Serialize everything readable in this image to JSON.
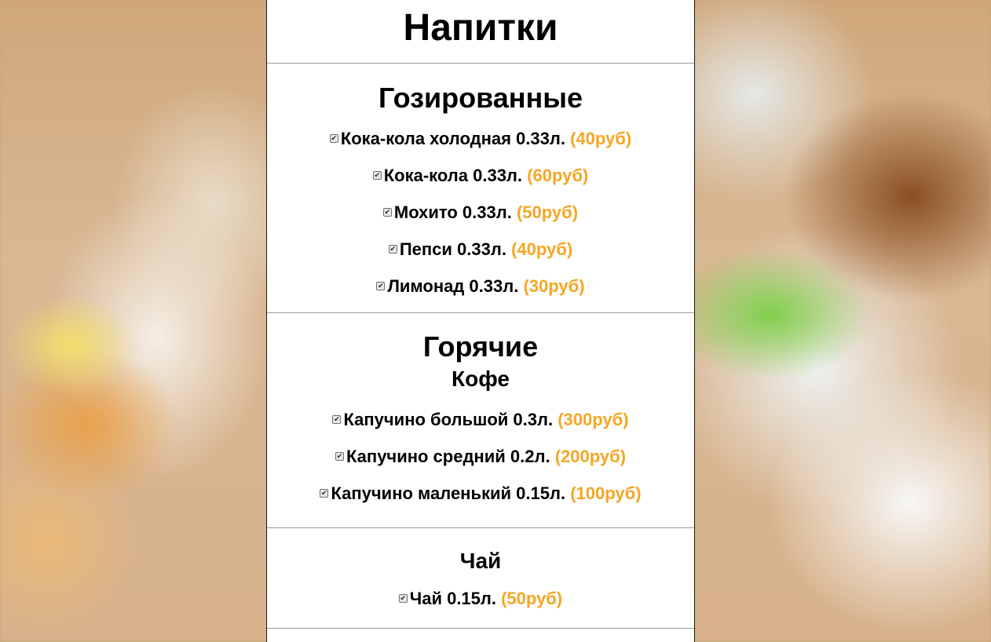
{
  "page": {
    "title": "Напитки",
    "check_glyph": "✔"
  },
  "colors": {
    "price": "#f5a623",
    "panel": "#ffffff",
    "divider": "#9a9a9a"
  },
  "sections": [
    {
      "title": "Гозированные",
      "items": [
        {
          "name": "Кока-кола холодная 0.33л.",
          "price": "(40руб)"
        },
        {
          "name": "Кока-кола 0.33л.",
          "price": "(60руб)"
        },
        {
          "name": "Мохито 0.33л.",
          "price": "(50руб)"
        },
        {
          "name": "Пепси 0.33л.",
          "price": "(40руб)"
        },
        {
          "name": "Лимонад 0.33л.",
          "price": "(30руб)"
        }
      ]
    },
    {
      "title": "Горячие",
      "subsections": [
        {
          "title": "Кофе",
          "items": [
            {
              "name": "Капучино большой 0.3л.",
              "price": "(300руб)"
            },
            {
              "name": "Капучино средний 0.2л.",
              "price": "(200руб)"
            },
            {
              "name": "Капучино маленький 0.15л.",
              "price": "(100руб)"
            }
          ]
        },
        {
          "title": "Чай",
          "items": [
            {
              "name": "Чай 0.15л.",
              "price": "(50руб)"
            }
          ]
        }
      ]
    }
  ]
}
